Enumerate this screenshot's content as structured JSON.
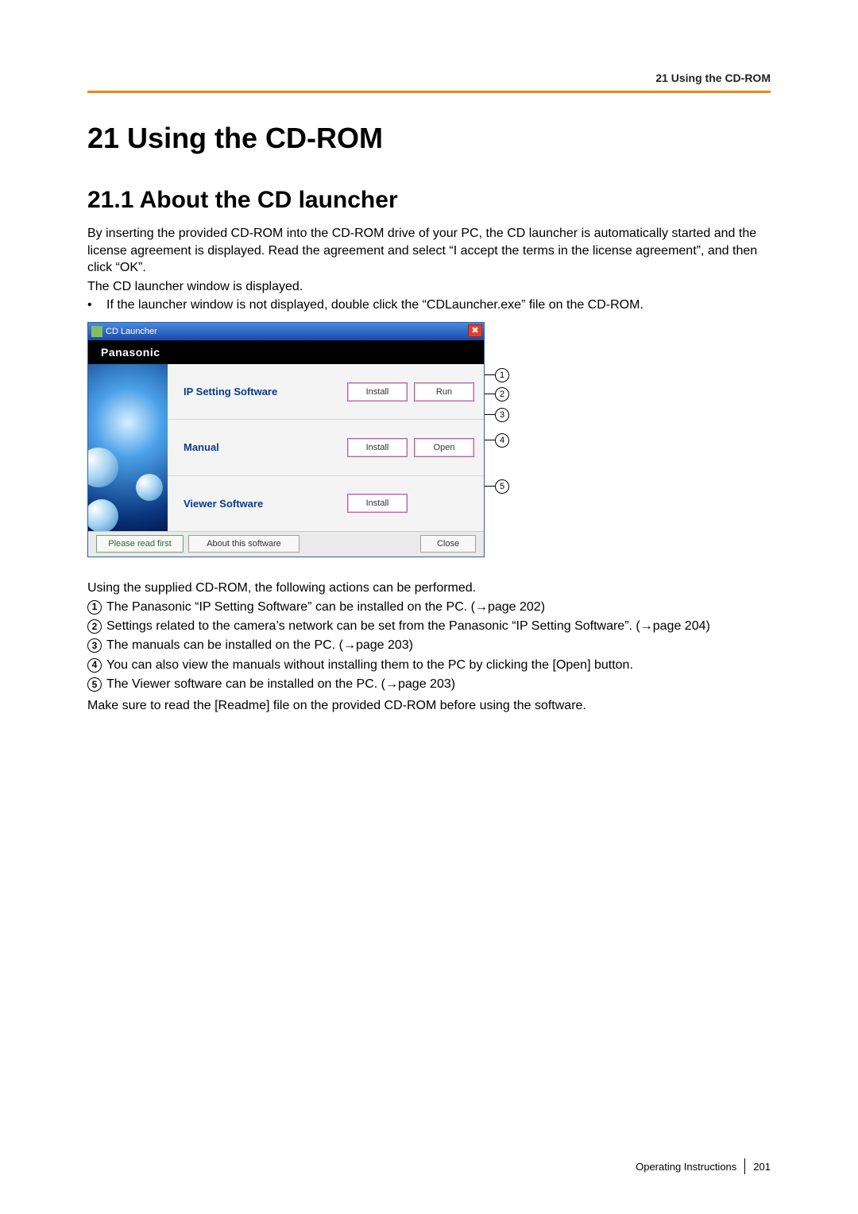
{
  "header": {
    "label": "21 Using the CD-ROM"
  },
  "chapter": {
    "title": "21   Using the CD-ROM"
  },
  "section": {
    "title": "21.1  About the CD launcher"
  },
  "intro": {
    "p1": "By inserting the provided CD-ROM into the CD-ROM drive of your PC, the CD launcher is automatically started and the license agreement is displayed. Read the agreement and select “I accept the terms in the license agreement”, and then click “OK”.",
    "p2": "The CD launcher window is displayed.",
    "bullet": "If the launcher window is not displayed, double click the “CDLauncher.exe” file on the CD-ROM."
  },
  "launcher": {
    "title": "CD Launcher",
    "close_x": "✖",
    "brand": "Panasonic",
    "rows": {
      "ip": {
        "label": "IP Setting Software",
        "btn1": "Install",
        "btn2": "Run"
      },
      "manual": {
        "label": "Manual",
        "btn1": "Install",
        "btn2": "Open"
      },
      "viewer": {
        "label": "Viewer Software",
        "btn1": "Install"
      }
    },
    "footer": {
      "readme": "Please read first",
      "about": "About this software",
      "close": "Close"
    },
    "callouts": {
      "c1": "1",
      "c2": "2",
      "c3": "3",
      "c4": "4",
      "c5": "5"
    }
  },
  "usage": {
    "lead": "Using the supplied CD-ROM, the following actions can be performed.",
    "items": [
      {
        "mark": "1",
        "text": "The Panasonic “IP Setting Software” can be installed on the PC. (→page 202)"
      },
      {
        "mark": "2",
        "text": "Settings related to the camera’s network can be set from the Panasonic “IP Setting Software”. (→page 204)"
      },
      {
        "mark": "3",
        "text": "The manuals can be installed on the PC. (→page 203)"
      },
      {
        "mark": "4",
        "text": "You can also view the manuals without installing them to the PC by clicking the [Open] button."
      },
      {
        "mark": "5",
        "text": "The Viewer software can be installed on the PC. (→page 203)"
      }
    ],
    "note": "Make sure to read the [Readme] file on the provided CD-ROM before using the software."
  },
  "footer": {
    "label": "Operating Instructions",
    "page": "201"
  }
}
